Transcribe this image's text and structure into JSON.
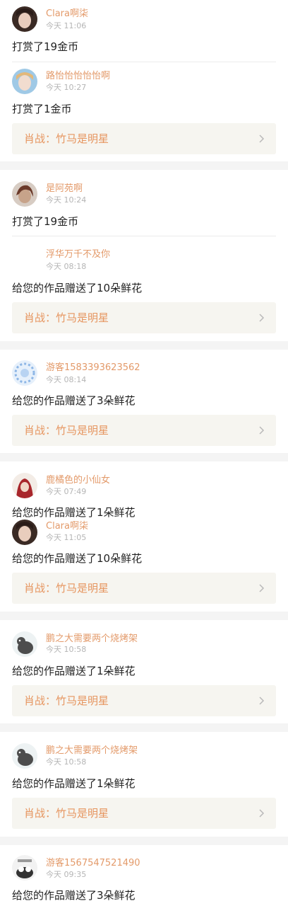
{
  "colors": {
    "accent_name": "#e39a6a",
    "work_text": "#e6955f",
    "work_bg": "#f6f5f0",
    "separator": "#f4f4f4"
  },
  "entries": [
    {
      "name": "Clara啊柒",
      "time": "今天 11:06",
      "message": "打赏了19金币",
      "avatar": "avatar-portrait"
    },
    {
      "name": "路怡怡怡怡怡啊",
      "time": "今天 10:27",
      "message": "打赏了1金币",
      "avatar": "avatar-portrait"
    },
    {
      "name": "是阿苑啊",
      "time": "今天 10:24",
      "message": "打赏了19金币",
      "avatar": "avatar-portrait"
    },
    {
      "name": "浮华万千不及你",
      "time": "今天 08:18",
      "message": "给您的作品赠送了10朵鲜花",
      "avatar": "avatar-blank"
    },
    {
      "name": "游客1583393623562",
      "time": "今天 08:14",
      "message": "给您的作品赠送了3朵鲜花",
      "avatar": "avatar-pattern"
    },
    {
      "name": "鹿橘色的小仙女",
      "time": "今天 07:49",
      "message": "给您的作品赠送了1朵鲜花",
      "avatar": "avatar-portrait"
    },
    {
      "name": "Clara啊柒",
      "time": "今天 11:05",
      "message": "给您的作品赠送了10朵鲜花",
      "avatar": "avatar-portrait"
    },
    {
      "name": "鹏之大需要两个烧烤架",
      "time": "今天 10:58",
      "message": "给您的作品赠送了1朵鲜花",
      "avatar": "avatar-cat"
    },
    {
      "name": "鹏之大需要两个烧烤架",
      "time": "今天 10:58",
      "message": "给您的作品赠送了1朵鲜花",
      "avatar": "avatar-cat"
    },
    {
      "name": "游客1567547521490",
      "time": "今天 09:35",
      "message": "给您的作品赠送了3朵鲜花",
      "avatar": "avatar-pattern"
    }
  ],
  "work_label": "肖战：竹马是明星"
}
